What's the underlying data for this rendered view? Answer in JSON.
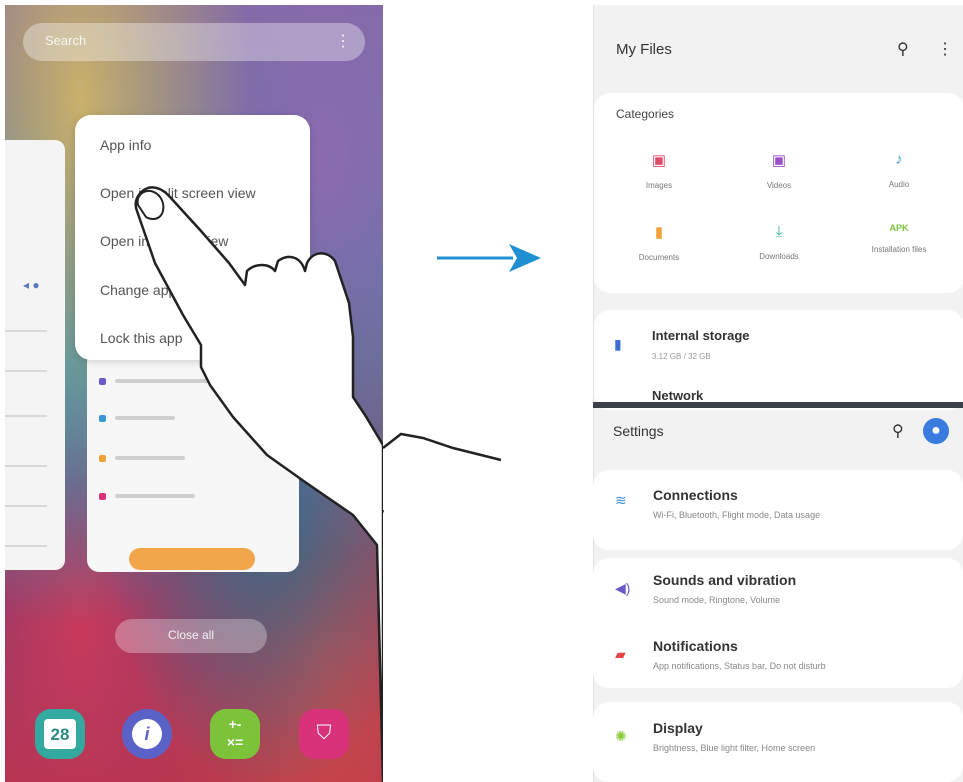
{
  "left_phone": {
    "search": {
      "placeholder": "Search",
      "menu_glyph": "⋮"
    },
    "bg_card_icons": "◂ ●",
    "popup_menu": {
      "items": [
        "App info",
        "Open in split screen view",
        "Open in pop-up view",
        "Change app",
        "Lock this app"
      ]
    },
    "close_all_label": "Close all",
    "dock": {
      "calendar_day": "28",
      "compass_glyph": "i",
      "calc_glyph": "+-\n×=",
      "store_glyph": "⛉"
    }
  },
  "right_phone": {
    "my_files": {
      "title": "My Files",
      "categories_title": "Categories",
      "categories": [
        {
          "label": "Images",
          "glyph": "▣",
          "color": "#e24a6a"
        },
        {
          "label": "Videos",
          "glyph": "▣",
          "color": "#9a4fc8"
        },
        {
          "label": "Audio",
          "glyph": "♪",
          "color": "#3a9ad8"
        },
        {
          "label": "Documents",
          "glyph": "▮",
          "color": "#f2a13a"
        },
        {
          "label": "Downloads",
          "glyph": "⤓",
          "color": "#2fae9c"
        },
        {
          "label": "Installation files",
          "glyph": "APK",
          "color": "#7cc33a"
        }
      ],
      "storage_title": "Internal storage",
      "storage_sub": "3.12 GB / 32 GB",
      "storage_next": "Network"
    },
    "settings": {
      "title": "Settings",
      "rows": [
        {
          "title": "Connections",
          "sub": "Wi-Fi, Bluetooth, Flight mode, Data usage",
          "glyph": "≋",
          "color": "#3a8ad8"
        },
        {
          "title": "Sounds and vibration",
          "sub": "Sound mode, Ringtone, Volume",
          "glyph": "◀)",
          "color": "#6a5cc8"
        },
        {
          "title": "Notifications",
          "sub": "App notifications, Status bar, Do not disturb",
          "glyph": "▰",
          "color": "#e0464a"
        },
        {
          "title": "Display",
          "sub": "Brightness, Blue light filter, Home screen",
          "glyph": "✺",
          "color": "#8acb3a"
        }
      ]
    }
  }
}
